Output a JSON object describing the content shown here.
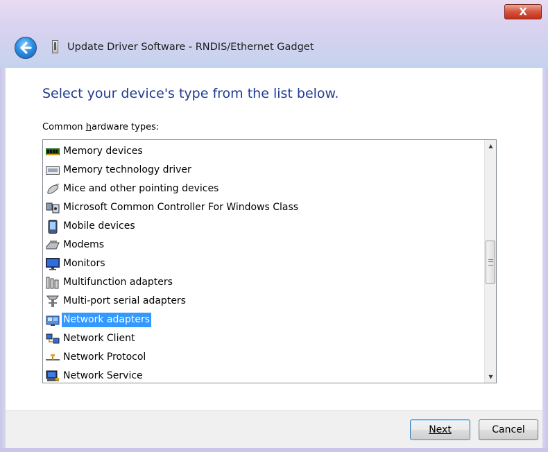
{
  "window": {
    "title": "Update Driver Software - RNDIS/Ethernet Gadget",
    "close_glyph": "X"
  },
  "main": {
    "heading": "Select your device's type from the list below.",
    "list_label_prefix": "Common ",
    "list_label_accel": "h",
    "list_label_rest": "ardware types:"
  },
  "hardware_types": [
    {
      "label": "Memory devices",
      "icon": "memory-chip-icon"
    },
    {
      "label": "Memory technology driver",
      "icon": "memory-driver-icon"
    },
    {
      "label": "Mice and other pointing devices",
      "icon": "mouse-icon"
    },
    {
      "label": "Microsoft Common Controller For Windows Class",
      "icon": "controller-icon"
    },
    {
      "label": "Mobile devices",
      "icon": "mobile-device-icon"
    },
    {
      "label": "Modems",
      "icon": "modem-icon"
    },
    {
      "label": "Monitors",
      "icon": "monitor-icon"
    },
    {
      "label": "Multifunction adapters",
      "icon": "multifunction-adapter-icon"
    },
    {
      "label": "Multi-port serial adapters",
      "icon": "serial-adapter-icon"
    },
    {
      "label": "Network adapters",
      "icon": "network-adapter-icon",
      "selected": true
    },
    {
      "label": "Network Client",
      "icon": "network-client-icon"
    },
    {
      "label": "Network Protocol",
      "icon": "network-protocol-icon"
    },
    {
      "label": "Network Service",
      "icon": "network-service-icon"
    }
  ],
  "footer": {
    "next_label": "Next",
    "cancel_label": "Cancel"
  },
  "colors": {
    "heading": "#1e3b8f",
    "selection": "#3399ff"
  }
}
